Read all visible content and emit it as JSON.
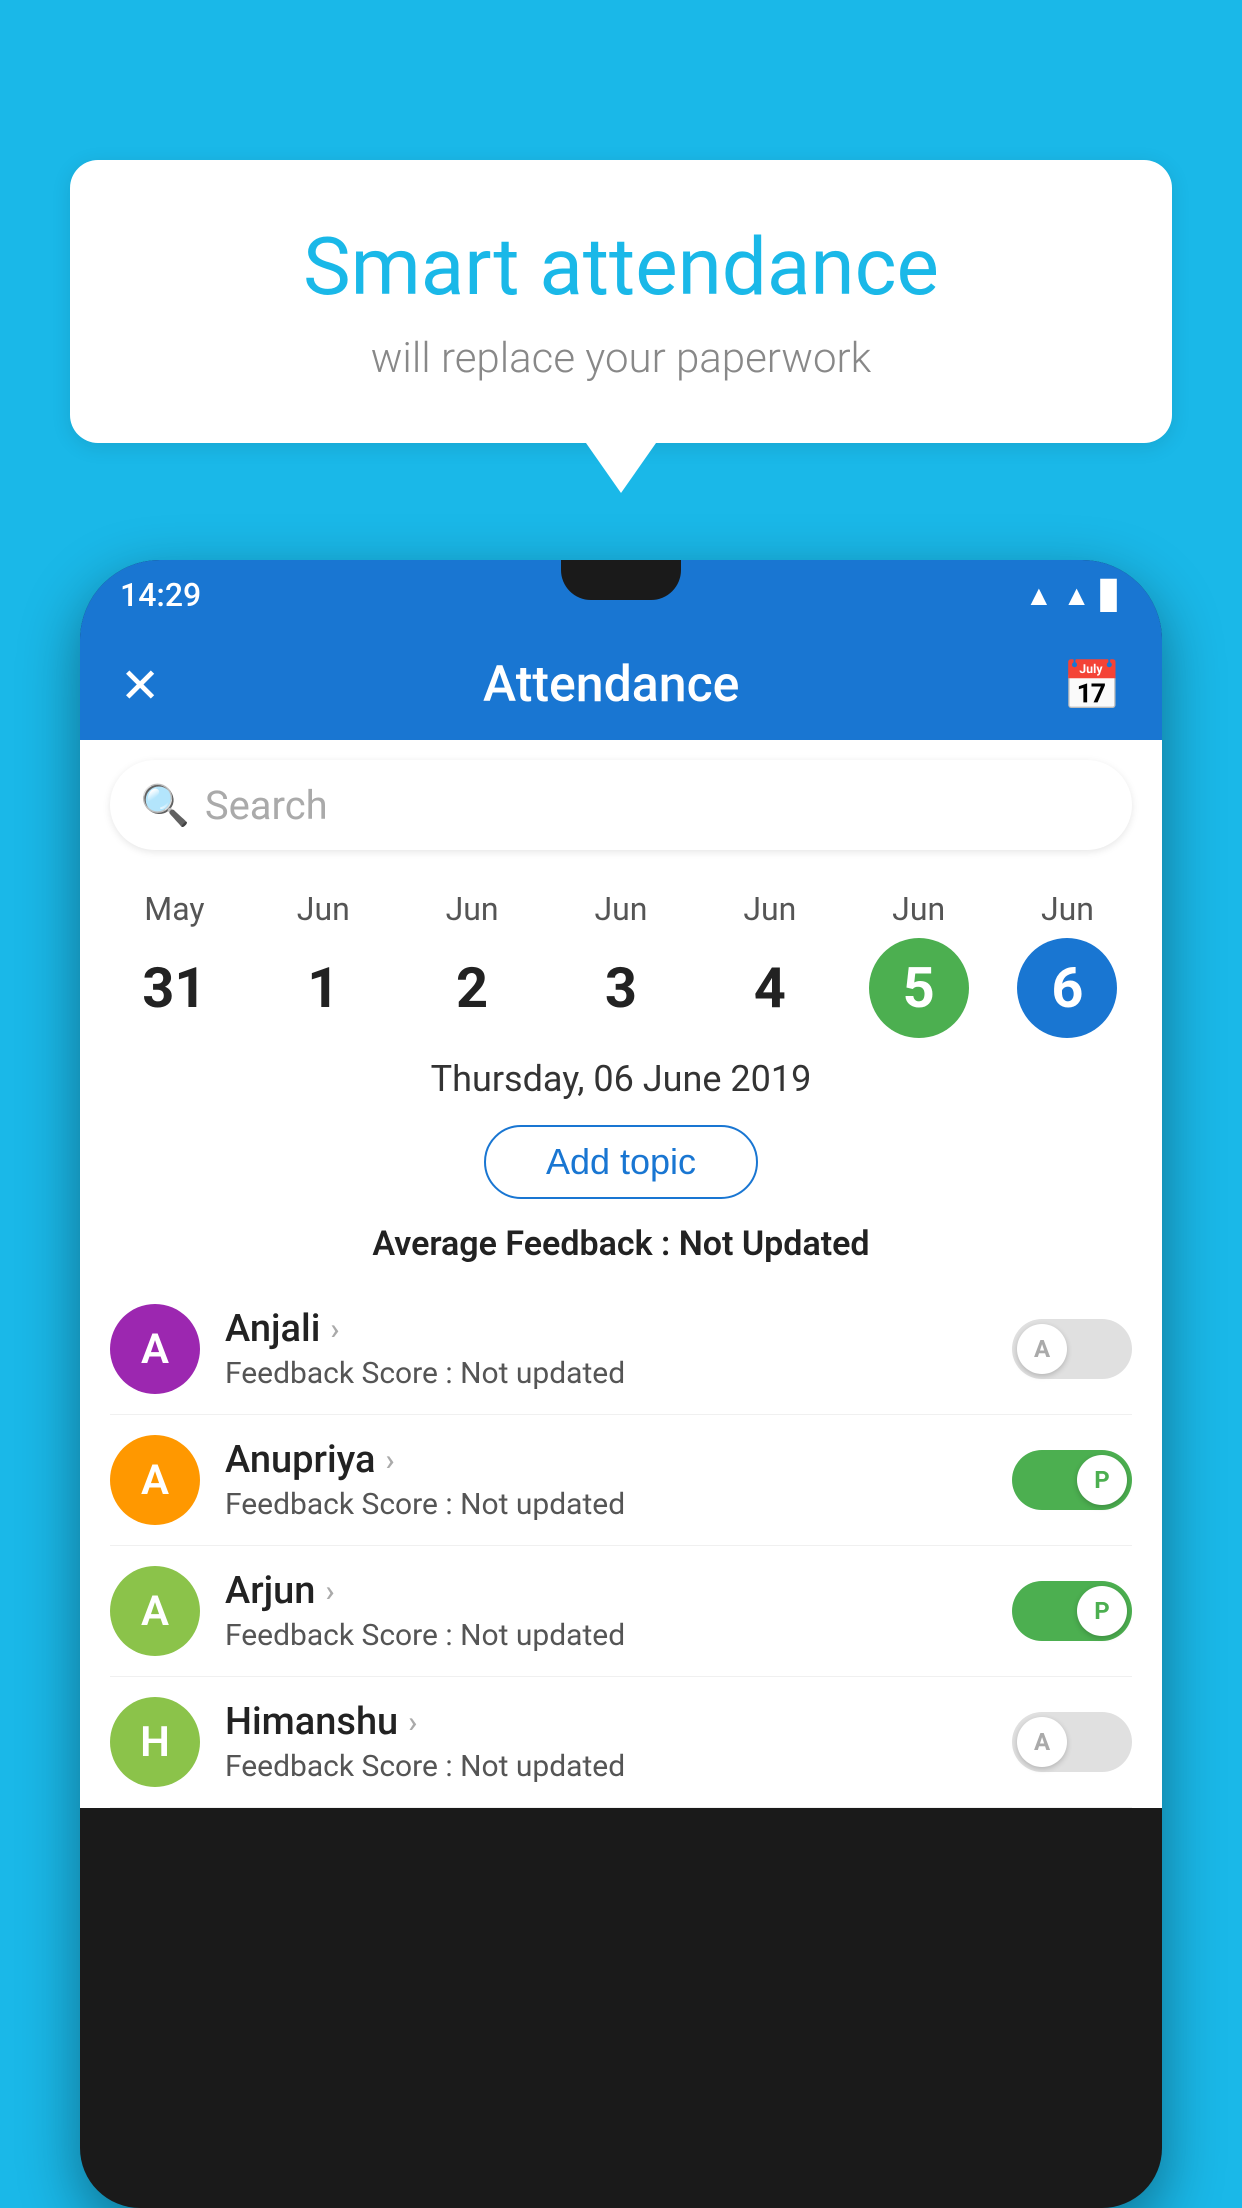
{
  "background_color": "#1ab8e8",
  "speech_bubble": {
    "title": "Smart attendance",
    "subtitle": "will replace your paperwork"
  },
  "status_bar": {
    "time": "14:29",
    "wifi": "▲",
    "signal": "▲",
    "battery": "▊"
  },
  "app_header": {
    "title": "Attendance",
    "close_icon": "✕",
    "calendar_icon": "📅"
  },
  "search": {
    "placeholder": "Search"
  },
  "calendar": {
    "days": [
      {
        "month": "May",
        "date": "31",
        "type": "normal"
      },
      {
        "month": "Jun",
        "date": "1",
        "type": "normal"
      },
      {
        "month": "Jun",
        "date": "2",
        "type": "normal"
      },
      {
        "month": "Jun",
        "date": "3",
        "type": "normal"
      },
      {
        "month": "Jun",
        "date": "4",
        "type": "normal"
      },
      {
        "month": "Jun",
        "date": "5",
        "type": "today"
      },
      {
        "month": "Jun",
        "date": "6",
        "type": "selected"
      }
    ]
  },
  "selected_date": "Thursday, 06 June 2019",
  "add_topic_label": "Add topic",
  "avg_feedback_label": "Average Feedback :",
  "avg_feedback_value": "Not Updated",
  "students": [
    {
      "name": "Anjali",
      "initial": "A",
      "avatar_color": "#9c27b0",
      "feedback_label": "Feedback Score :",
      "feedback_value": "Not updated",
      "attendance": "absent",
      "toggle_label": "A"
    },
    {
      "name": "Anupriya",
      "initial": "A",
      "avatar_color": "#ff9800",
      "feedback_label": "Feedback Score :",
      "feedback_value": "Not updated",
      "attendance": "present",
      "toggle_label": "P"
    },
    {
      "name": "Arjun",
      "initial": "A",
      "avatar_color": "#8bc34a",
      "feedback_label": "Feedback Score :",
      "feedback_value": "Not updated",
      "attendance": "present",
      "toggle_label": "P"
    },
    {
      "name": "Himanshu",
      "initial": "H",
      "avatar_color": "#8bc34a",
      "feedback_label": "Feedback Score :",
      "feedback_value": "Not updated",
      "attendance": "absent",
      "toggle_label": "A"
    }
  ]
}
